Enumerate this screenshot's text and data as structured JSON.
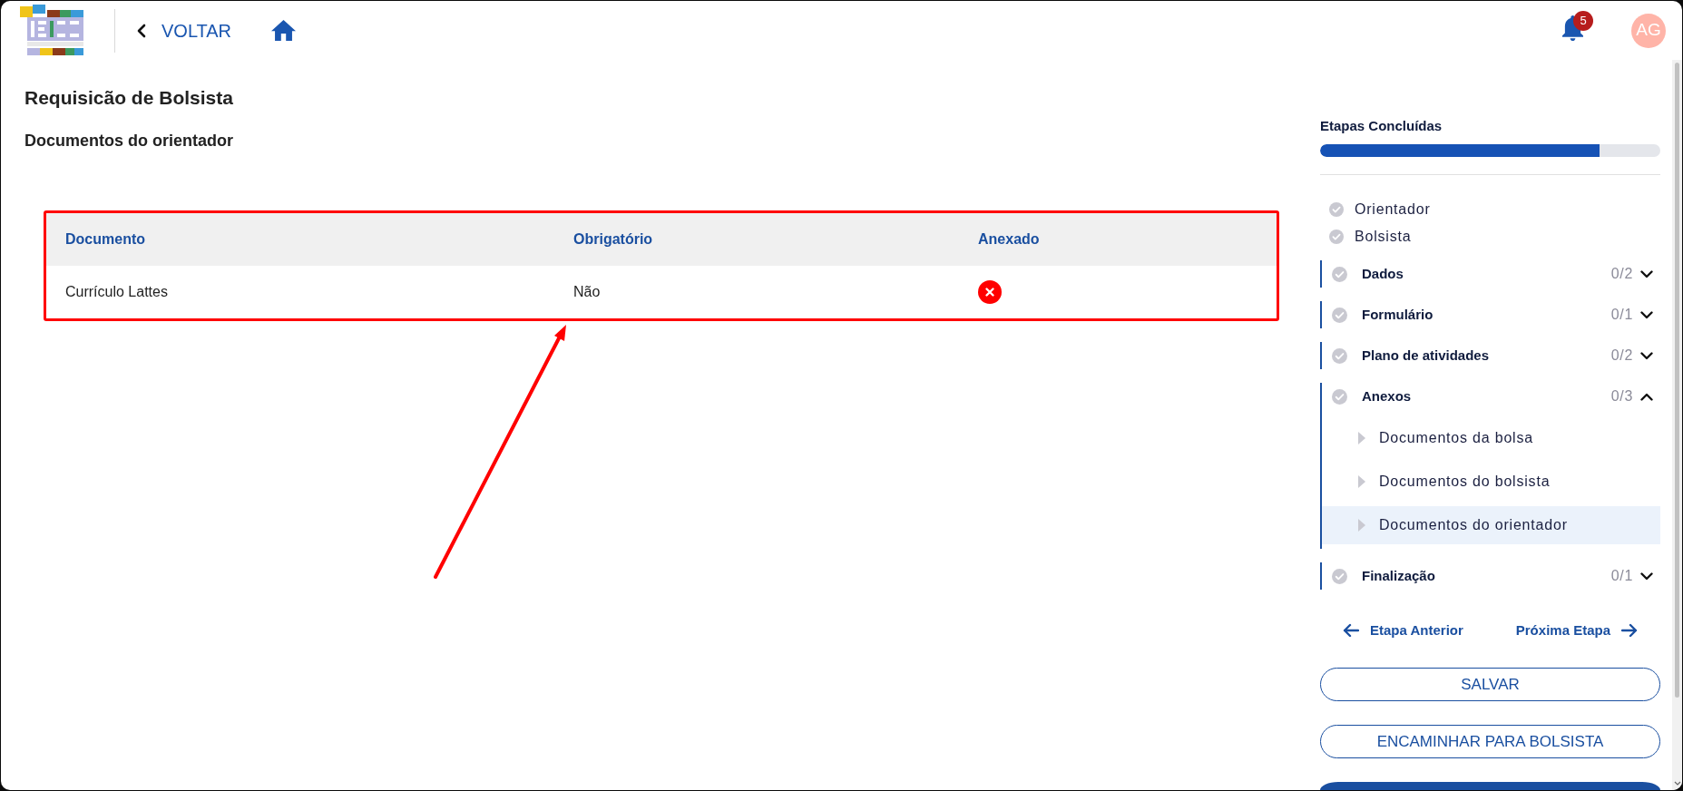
{
  "header": {
    "back_label": "VOLTAR",
    "notifications": {
      "count": "5"
    },
    "avatar": {
      "initials": "AG"
    }
  },
  "page": {
    "title": "Requisicão de Bolsista",
    "subtitle": "Documentos do orientador"
  },
  "table": {
    "columns": [
      "Documento",
      "Obrigatório",
      "Anexado"
    ],
    "rows": [
      {
        "document": "Currículo Lattes",
        "required": "Não",
        "attached": false
      }
    ]
  },
  "steps_panel": {
    "title": "Etapas Concluídas",
    "progress": {
      "level": 0.82
    },
    "participants": [
      {
        "label": "Orientador"
      },
      {
        "label": "Bolsista"
      }
    ],
    "steps": [
      {
        "label": "Dados",
        "count": "0/2",
        "expanded": false
      },
      {
        "label": "Formulário",
        "count": "0/1",
        "expanded": false
      },
      {
        "label": "Plano de atividades",
        "count": "0/2",
        "expanded": false
      },
      {
        "label": "Anexos",
        "count": "0/3",
        "expanded": true,
        "children": [
          {
            "label": "Documentos da bolsa",
            "selected": false
          },
          {
            "label": "Documentos do bolsista",
            "selected": false
          },
          {
            "label": "Documentos do orientador",
            "selected": true
          }
        ]
      },
      {
        "label": "Finalização",
        "count": "0/1",
        "expanded": false
      }
    ],
    "navigation": {
      "previous": "Etapa Anterior",
      "next": "Próxima Etapa"
    },
    "buttons": [
      {
        "label": "SALVAR",
        "kind": "outline"
      },
      {
        "label": "ENCAMINHAR PARA BOLSISTA",
        "kind": "outline"
      },
      {
        "kind": "filled"
      }
    ]
  }
}
